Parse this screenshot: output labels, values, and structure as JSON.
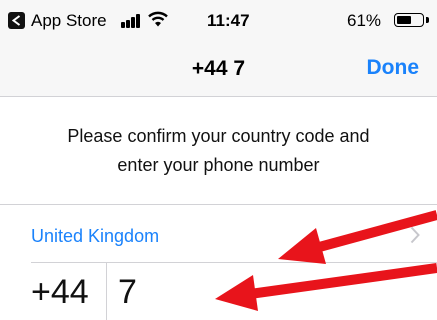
{
  "status_bar": {
    "back_label": "App Store",
    "time": "11:47",
    "battery_percent": "61%",
    "battery_level": 0.61,
    "signal_icon": "signal-bars-icon",
    "wifi_icon": "wifi-icon"
  },
  "nav": {
    "title": "+44 7",
    "done_label": "Done"
  },
  "prompt": {
    "line1": "Please confirm your country code and",
    "line2": "enter your phone number"
  },
  "country": {
    "name": "United Kingdom"
  },
  "phone": {
    "code": "+44",
    "number": "7"
  },
  "colors": {
    "accent": "#1a82fb",
    "annotation_arrow": "#e8141b",
    "nav_background": "#f7f7f7"
  }
}
